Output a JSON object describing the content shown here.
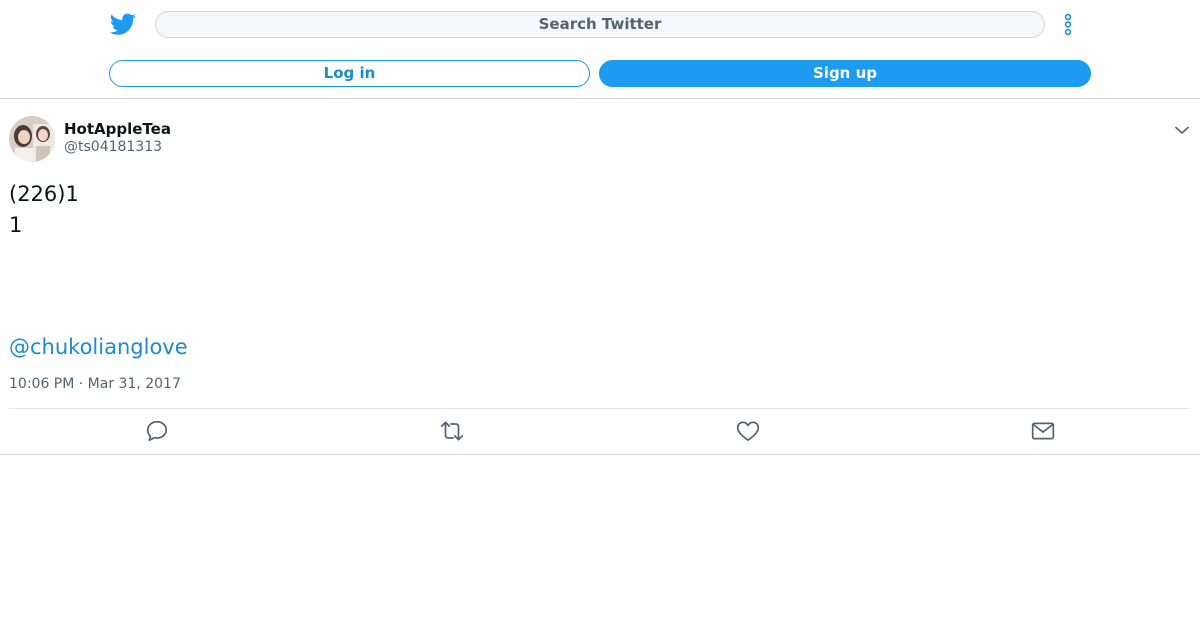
{
  "header": {
    "logo_icon": "twitter-bird-icon",
    "search_placeholder": "Search Twitter",
    "more_icon": "more-vertical-icon",
    "login_label": "Log in",
    "signup_label": "Sign up"
  },
  "tweet": {
    "author_name": "HotAppleTea",
    "author_handle": "@ts04181313",
    "text_line_1": "(226)1",
    "text_line_2": "1",
    "mention": "@chukolianglove",
    "timestamp": "10:06 PM · Mar 31, 2017",
    "actions": [
      "reply-icon",
      "retweet-icon",
      "like-icon",
      "message-icon"
    ]
  },
  "colors": {
    "brand_blue": "#1d9bf0",
    "link_blue": "#1d8bd0",
    "secondary_text": "#536471",
    "border": "#cfd9de"
  }
}
